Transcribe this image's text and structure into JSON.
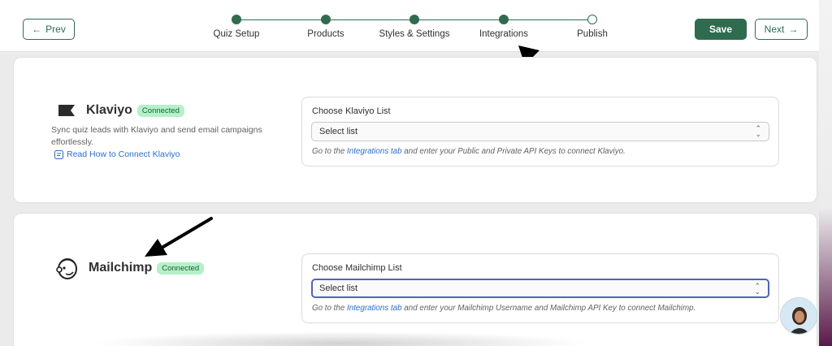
{
  "nav": {
    "prev_label": "Prev",
    "next_label": "Next",
    "save_label": "Save"
  },
  "steps": [
    {
      "label": "Quiz Setup",
      "done": true
    },
    {
      "label": "Products",
      "done": true
    },
    {
      "label": "Styles & Settings",
      "done": true
    },
    {
      "label": "Integrations",
      "done": true
    },
    {
      "label": "Publish",
      "done": false
    }
  ],
  "klaviyo": {
    "name": "Klaviyo",
    "status": "Connected",
    "description": "Sync quiz leads with Klaviyo and send email campaigns effortlessly.",
    "link_text": "Read How to Connect Klaviyo",
    "select_label": "Choose Klaviyo List",
    "select_value": "Select list",
    "help_pre": "Go to the ",
    "help_link": "Integrations tab",
    "help_post": " and enter your Public and Private API Keys to connect Klaviyo."
  },
  "mailchimp": {
    "name": "Mailchimp",
    "status": "Connected",
    "select_label": "Choose Mailchimp List",
    "select_value": "Select list",
    "help_pre": "Go to the ",
    "help_link": "Integrations tab",
    "help_post": " and enter your Mailchimp Username and Mailchimp API Key to connect Mailchimp."
  },
  "colors": {
    "accent": "#2f6b4f",
    "badge_bg": "#b4f0c8",
    "link": "#2c6ecb",
    "focus": "#4f64b8"
  }
}
